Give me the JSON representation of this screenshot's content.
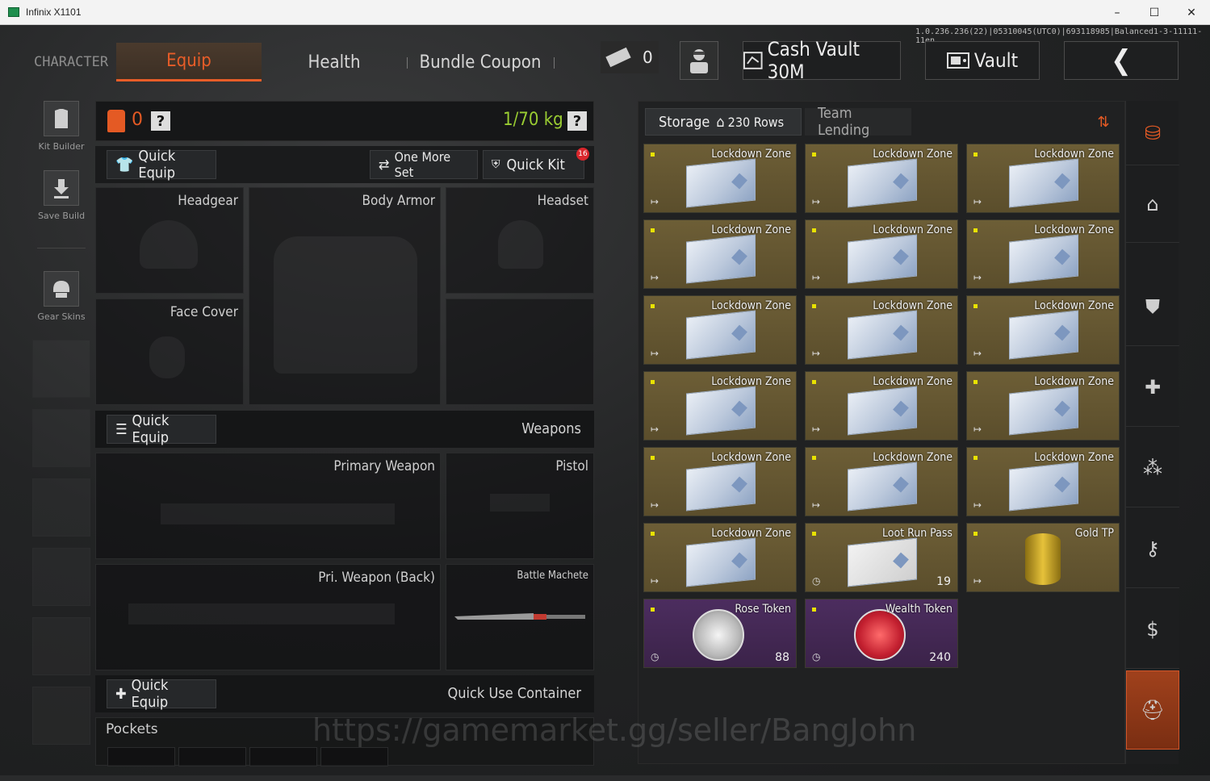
{
  "window": {
    "title": "Infinix X1101",
    "minimize": "–",
    "maximize": "☐",
    "close": "✕"
  },
  "sys_info": "1.0.236.236(22)|05310045(UTC0)|693118985|Balanced1-3-11111-11en",
  "nav": {
    "character": "CHARACTER",
    "tabs": [
      {
        "label": "Equip",
        "active": true
      },
      {
        "label": "Health"
      },
      {
        "label": "Bundle Coupon"
      }
    ]
  },
  "toolbar": {
    "ticket_count": "0",
    "cash_vault": "Cash Vault 30M",
    "vault": "Vault",
    "back": "❮"
  },
  "left_rail": {
    "kit_builder": "Kit Builder",
    "save_build": "Save Build",
    "gear_skins": "Gear Skins"
  },
  "equip_header": {
    "bag_count": "0",
    "help": "?",
    "weight": "1/70 kg"
  },
  "quick_bar": {
    "quick_equip": "Quick Equip",
    "one_more_set": "One More Set",
    "quick_kit": "Quick Kit",
    "quick_kit_badge": "16"
  },
  "gear_slots": {
    "headgear": "Headgear",
    "body_armor": "Body Armor",
    "headset": "Headset",
    "face_cover": "Face Cover"
  },
  "weapons_section": {
    "quick_equip": "Quick Equip",
    "title": "Weapons",
    "primary": "Primary Weapon",
    "pistol": "Pistol",
    "primary_back": "Pri. Weapon (Back)",
    "melee": "Battle Machete"
  },
  "quick_use_section": {
    "quick_equip": "Quick Equip",
    "title": "Quick Use Container",
    "pockets": "Pockets"
  },
  "storage": {
    "tab_storage": "Storage",
    "rows": "230 Rows",
    "tab_lending": "Team Lending",
    "items": [
      {
        "name": "Lockdown Zone",
        "kind": "card",
        "tier": "gold"
      },
      {
        "name": "Lockdown Zone",
        "kind": "card",
        "tier": "gold"
      },
      {
        "name": "Lockdown Zone",
        "kind": "card",
        "tier": "gold"
      },
      {
        "name": "Lockdown Zone",
        "kind": "card",
        "tier": "gold"
      },
      {
        "name": "Lockdown Zone",
        "kind": "card",
        "tier": "gold"
      },
      {
        "name": "Lockdown Zone",
        "kind": "card",
        "tier": "gold"
      },
      {
        "name": "Lockdown Zone",
        "kind": "card",
        "tier": "gold"
      },
      {
        "name": "Lockdown Zone",
        "kind": "card",
        "tier": "gold"
      },
      {
        "name": "Lockdown Zone",
        "kind": "card",
        "tier": "gold"
      },
      {
        "name": "Lockdown Zone",
        "kind": "card",
        "tier": "gold"
      },
      {
        "name": "Lockdown Zone",
        "kind": "card",
        "tier": "gold"
      },
      {
        "name": "Lockdown Zone",
        "kind": "card",
        "tier": "gold"
      },
      {
        "name": "Lockdown Zone",
        "kind": "card",
        "tier": "gold"
      },
      {
        "name": "Lockdown Zone",
        "kind": "card",
        "tier": "gold"
      },
      {
        "name": "Lockdown Zone",
        "kind": "card",
        "tier": "gold"
      },
      {
        "name": "Lockdown Zone",
        "kind": "card",
        "tier": "gold"
      },
      {
        "name": "Loot Run Pass",
        "kind": "pass",
        "tier": "gold",
        "qty": "19"
      },
      {
        "name": "Gold TP",
        "kind": "tp",
        "tier": "gold"
      },
      {
        "name": "Rose Token",
        "kind": "token",
        "tier": "purple",
        "qty": "88"
      },
      {
        "name": "Wealth Token",
        "kind": "token-red",
        "tier": "purple",
        "qty": "240"
      }
    ]
  },
  "watermark": "https://gamemarket.gg/seller/BangJohn",
  "colors": {
    "accent": "#e45a24",
    "weight": "#9acd32",
    "gold_item": "#6d5e36",
    "purple_item": "#4c2d5f"
  }
}
